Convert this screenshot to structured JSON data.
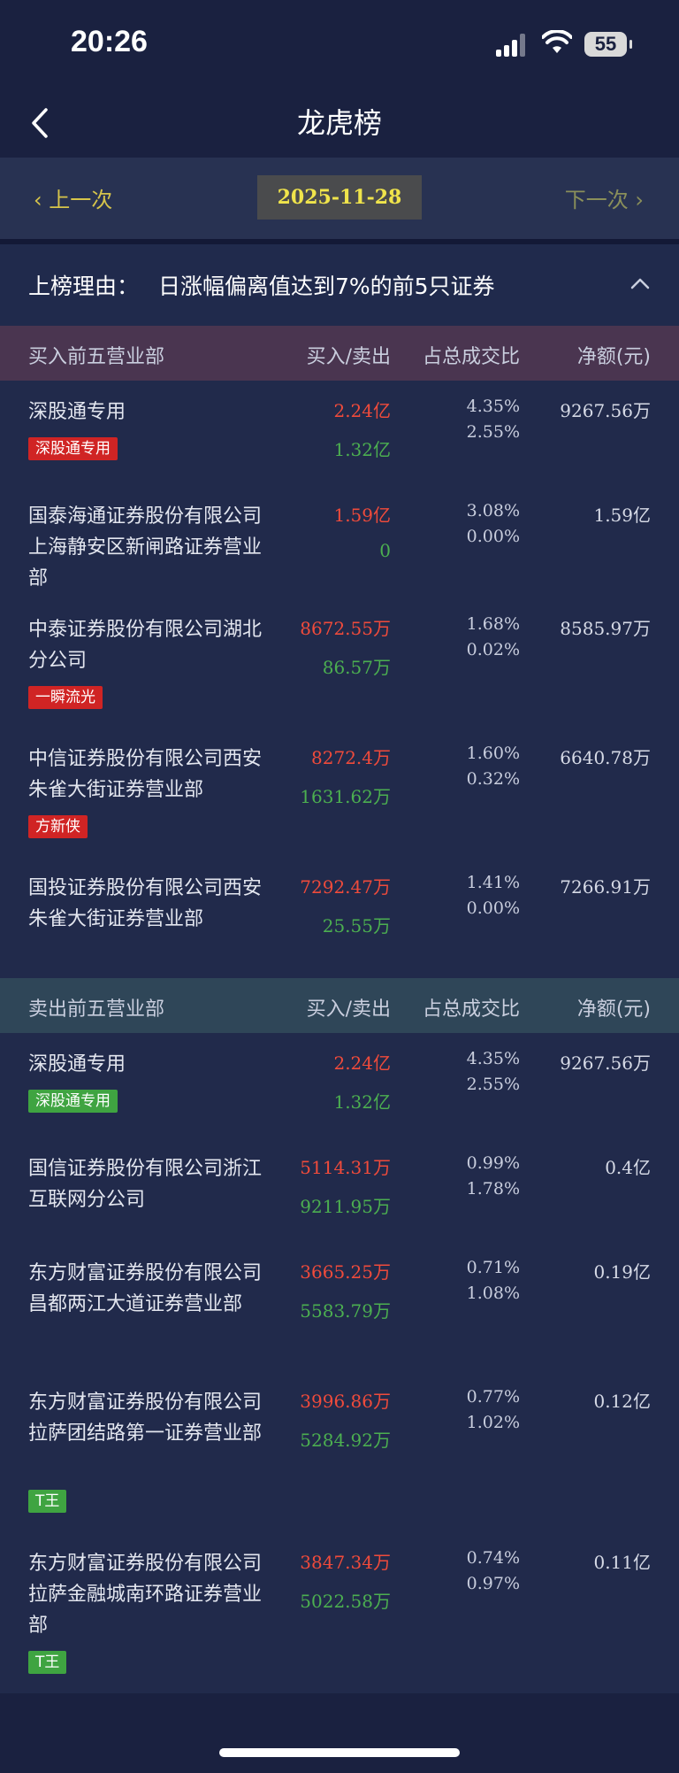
{
  "status_bar": {
    "time": "20:26",
    "battery": "55"
  },
  "nav": {
    "title": "龙虎榜"
  },
  "date_nav": {
    "prev_label": "上一次",
    "next_label": "下一次",
    "date": "2025-11-28"
  },
  "reason": {
    "label": "上榜理由：",
    "text": "日涨幅偏离值达到7%的前5只证券"
  },
  "columns": {
    "buy_section": "买入前五营业部",
    "sell_section": "卖出前五营业部",
    "buy_sell": "买入/卖出",
    "ratio": "占总成交比",
    "net": "净额(元)"
  },
  "buy_rows": [
    {
      "name": "深股通专用",
      "tag": "深股通专用",
      "buy": "2.24亿",
      "sell": "1.32亿",
      "buy_pct": "4.35%",
      "sell_pct": "2.55%",
      "net": "9267.56万"
    },
    {
      "name": "国泰海通证券股份有限公司上海静安区新闸路证券营业部",
      "tag": "",
      "buy": "1.59亿",
      "sell": "0",
      "buy_pct": "3.08%",
      "sell_pct": "0.00%",
      "net": "1.59亿"
    },
    {
      "name": "中泰证券股份有限公司湖北分公司",
      "tag": "一瞬流光",
      "buy": "8672.55万",
      "sell": "86.57万",
      "buy_pct": "1.68%",
      "sell_pct": "0.02%",
      "net": "8585.97万"
    },
    {
      "name": "中信证券股份有限公司西安朱雀大街证券营业部",
      "tag": "方新侠",
      "buy": "8272.4万",
      "sell": "1631.62万",
      "buy_pct": "1.60%",
      "sell_pct": "0.32%",
      "net": "6640.78万"
    },
    {
      "name": "国投证券股份有限公司西安朱雀大街证券营业部",
      "tag": "",
      "buy": "7292.47万",
      "sell": "25.55万",
      "buy_pct": "1.41%",
      "sell_pct": "0.00%",
      "net": "7266.91万"
    }
  ],
  "sell_rows": [
    {
      "name": "深股通专用",
      "tag": "深股通专用",
      "buy": "2.24亿",
      "sell": "1.32亿",
      "buy_pct": "4.35%",
      "sell_pct": "2.55%",
      "net": "9267.56万"
    },
    {
      "name": "国信证券股份有限公司浙江互联网分公司",
      "tag": "",
      "buy": "5114.31万",
      "sell": "9211.95万",
      "buy_pct": "0.99%",
      "sell_pct": "1.78%",
      "net": "0.4亿"
    },
    {
      "name": "东方财富证券股份有限公司昌都两江大道证券营业部",
      "tag": "",
      "buy": "3665.25万",
      "sell": "5583.79万",
      "buy_pct": "0.71%",
      "sell_pct": "1.08%",
      "net": "0.19亿"
    },
    {
      "name": "东方财富证券股份有限公司拉萨团结路第一证券营业部",
      "tag": "T王",
      "buy": "3996.86万",
      "sell": "5284.92万",
      "buy_pct": "0.77%",
      "sell_pct": "1.02%",
      "net": "0.12亿"
    },
    {
      "name": "东方财富证券股份有限公司拉萨金融城南环路证券营业部",
      "tag": "T王",
      "buy": "3847.34万",
      "sell": "5022.58万",
      "buy_pct": "0.74%",
      "sell_pct": "0.97%",
      "net": "0.11亿"
    }
  ]
}
